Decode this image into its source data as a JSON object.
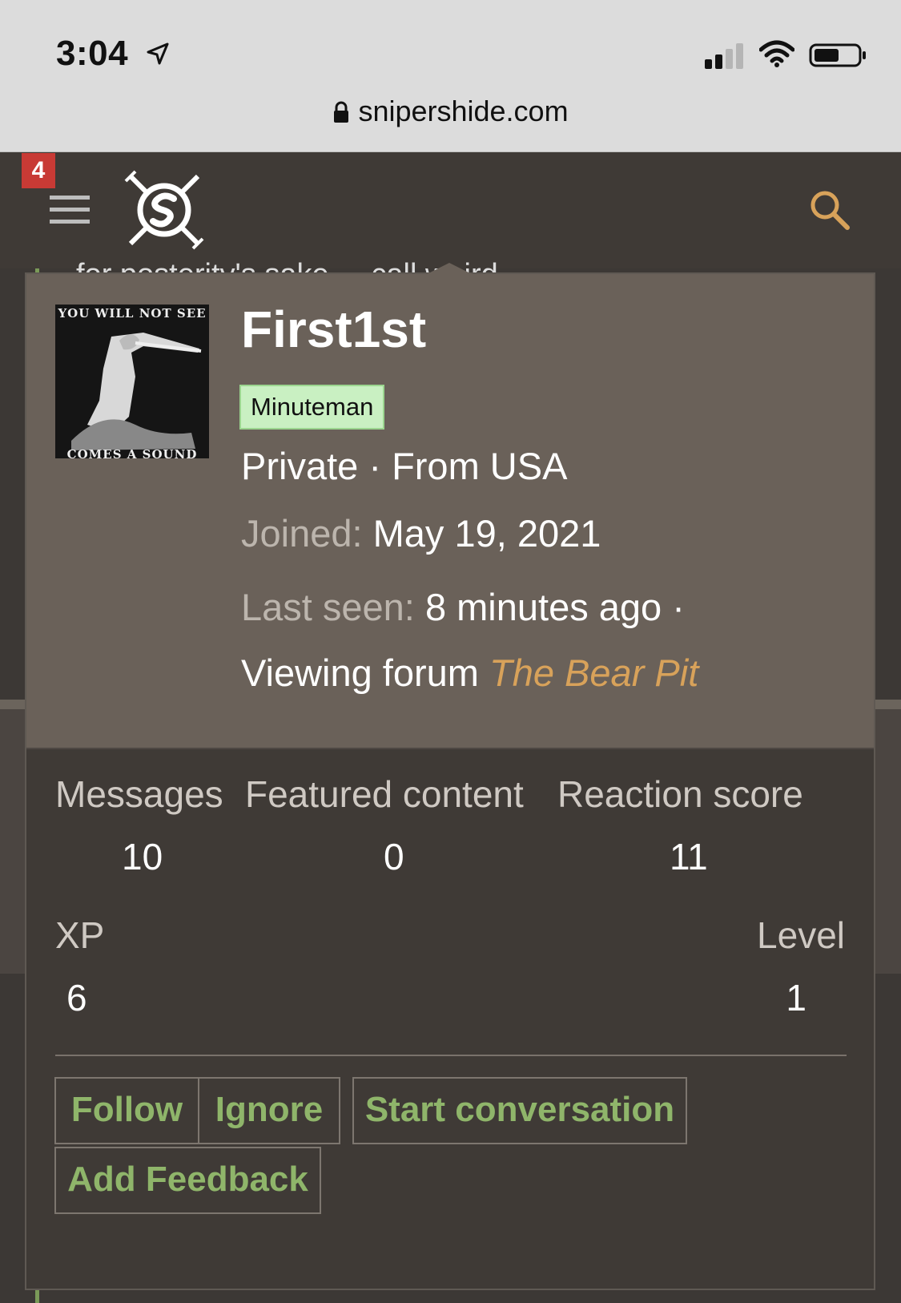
{
  "status_bar": {
    "time": "3:04"
  },
  "browser": {
    "url": "snipershide.com"
  },
  "header": {
    "notification_count": "4"
  },
  "background": {
    "partial_text": "for posterity's sake ... call weird"
  },
  "profile": {
    "avatar_text_top": "YOU WILL NOT SEE",
    "avatar_text_bottom": "COMES A SOUND",
    "username": "First1st",
    "role_badge": "Minuteman",
    "rank": "Private",
    "separator": "·",
    "location": "From USA",
    "joined_label": "Joined:",
    "joined_value": "May 19, 2021",
    "last_seen_label": "Last seen:",
    "last_seen_value": "8 minutes ago ·",
    "viewing_prefix": "Viewing forum",
    "viewing_forum": "The Bear Pit"
  },
  "stats": {
    "messages_label": "Messages",
    "messages_value": "10",
    "featured_label": "Featured content",
    "featured_value": "0",
    "reaction_label": "Reaction score",
    "reaction_value": "11",
    "xp_label": "XP",
    "xp_value": "6",
    "level_label": "Level",
    "level_value": "1"
  },
  "actions": {
    "follow": "Follow",
    "ignore": "Ignore",
    "start_conversation": "Start conversation",
    "add_feedback": "Add Feedback"
  },
  "colors": {
    "accent_link": "#d8a25a",
    "button_text": "#8fb56a",
    "badge_bg": "#c9f0c2",
    "notification_red": "#c83a35"
  }
}
